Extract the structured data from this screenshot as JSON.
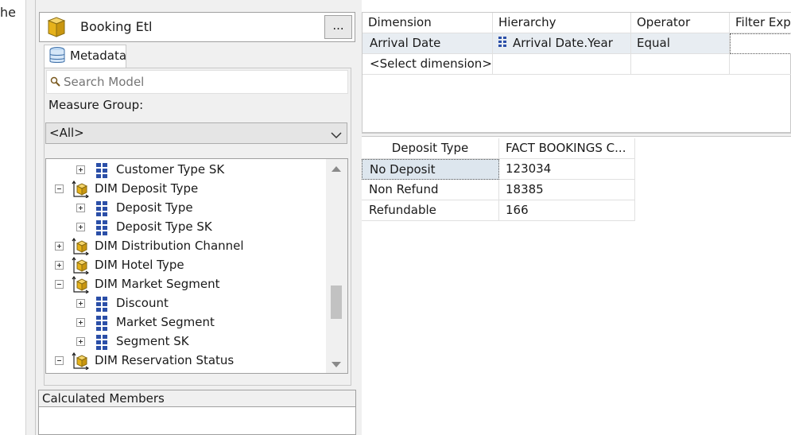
{
  "left_strip": {
    "text": "he"
  },
  "cube": {
    "name": "Booking Etl",
    "browse_label": "..."
  },
  "metadata_tab": {
    "label": "Metadata"
  },
  "search": {
    "placeholder": "Search Model"
  },
  "measure_group": {
    "label": "Measure Group:",
    "value": "<All>"
  },
  "tree": {
    "items": [
      {
        "label": "Customer Type SK",
        "kind": "attribute",
        "expander": "plus"
      },
      {
        "label": "DIM Deposit Type",
        "kind": "dimension",
        "expander": "minus"
      },
      {
        "label": "Deposit Type",
        "kind": "attribute",
        "expander": "plus"
      },
      {
        "label": "Deposit Type SK",
        "kind": "attribute",
        "expander": "plus"
      },
      {
        "label": "DIM Distribution Channel",
        "kind": "dimension",
        "expander": "plus"
      },
      {
        "label": "DIM Hotel Type",
        "kind": "dimension",
        "expander": "plus"
      },
      {
        "label": "DIM Market Segment",
        "kind": "dimension",
        "expander": "minus"
      },
      {
        "label": "Discount",
        "kind": "attribute",
        "expander": "plus"
      },
      {
        "label": "Market Segment",
        "kind": "attribute",
        "expander": "plus"
      },
      {
        "label": "Segment SK",
        "kind": "attribute",
        "expander": "plus"
      },
      {
        "label": "DIM Reservation Status",
        "kind": "dimension",
        "expander": "minus"
      }
    ]
  },
  "calculated_members": {
    "label": "Calculated Members"
  },
  "filter_grid": {
    "headers": [
      "Dimension",
      "Hierarchy",
      "Operator",
      "Filter Expr"
    ],
    "rows": [
      {
        "dimension": "Arrival Date",
        "hierarchy": "Arrival Date.Year",
        "operator": "Equal",
        "filter_expression": ""
      },
      {
        "dimension": "<Select dimension>",
        "hierarchy": "",
        "operator": "",
        "filter_expression": ""
      }
    ]
  },
  "results_grid": {
    "headers": [
      "Deposit Type",
      "FACT BOOKINGS C..."
    ],
    "rows": [
      {
        "deposit_type": "No Deposit",
        "value": "123034"
      },
      {
        "deposit_type": "Non Refund",
        "value": "18385"
      },
      {
        "deposit_type": "Refundable",
        "value": "166"
      }
    ]
  },
  "colors": {
    "panel_bg": "#f0f0f0",
    "selected_row_bg": "#e8edf2",
    "attribute_icon": "#2b4fa8",
    "dimension_icon": "#e6b21a"
  },
  "icons": {
    "cube": "cube-icon",
    "metadata": "metadata-icon",
    "search": "search-icon",
    "attribute": "attribute-hierarchy-icon",
    "dimension": "dimension-icon"
  }
}
